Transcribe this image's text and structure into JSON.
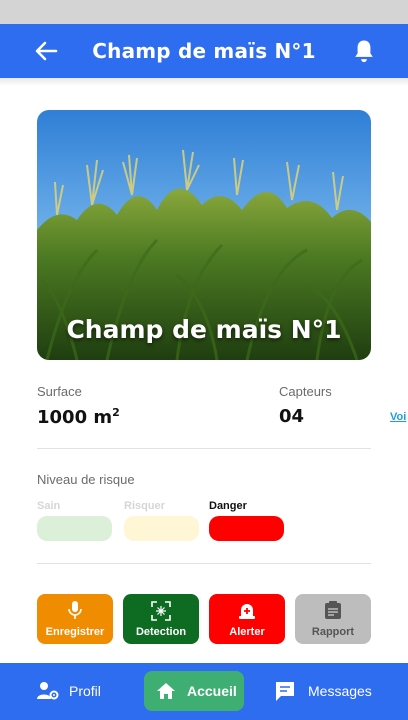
{
  "header": {
    "title": "Champ de maïs N°1",
    "back_icon": "arrow-left-icon",
    "notification_icon": "bell-icon"
  },
  "hero": {
    "title": "Champ de maïs N°1",
    "image": "corn-field-photo"
  },
  "stats": {
    "surface": {
      "label": "Surface",
      "value": "1000 m",
      "unit_exponent": "2"
    },
    "capteurs": {
      "label": "Capteurs",
      "value": "04"
    },
    "voir_link": "Voi"
  },
  "risk": {
    "label": "Niveau de risque",
    "levels": [
      {
        "label": "Sain",
        "color": "#dcefd9",
        "text_color": "#d6d6d6"
      },
      {
        "label": "Risquer",
        "color": "#fff6d6",
        "text_color": "#d6d6d6"
      },
      {
        "label": "Danger",
        "color": "#ff0000",
        "text_color": "#111111"
      }
    ],
    "selected": "Danger"
  },
  "actions": [
    {
      "label": "Enregistrer",
      "icon": "microphone-icon",
      "color": "#f08c00"
    },
    {
      "label": "Detection",
      "icon": "scan-icon",
      "color": "#0e6b22"
    },
    {
      "label": "Alerter",
      "icon": "alarm-icon",
      "color": "#ff0000"
    },
    {
      "label": "Rapport",
      "icon": "clipboard-icon",
      "color": "#bdbdbd"
    }
  ],
  "bottom_nav": [
    {
      "label": "Profil",
      "icon": "user-settings-icon"
    },
    {
      "label": "Accueil",
      "icon": "home-icon",
      "active": true
    },
    {
      "label": "Messages",
      "icon": "chat-icon"
    }
  ],
  "colors": {
    "primary": "#2e6cf0",
    "active_nav": "#3fae73"
  }
}
